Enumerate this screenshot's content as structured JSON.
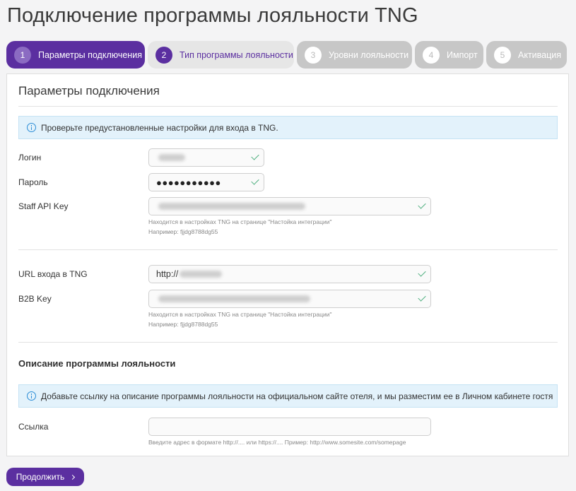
{
  "page": {
    "title": "Подключение программы лояльности TNG"
  },
  "steps": [
    {
      "num": "1",
      "label": "Параметры подключения",
      "state": "active"
    },
    {
      "num": "2",
      "label": "Тип программы лояльности",
      "state": "done"
    },
    {
      "num": "3",
      "label": "Уровни лояльности",
      "state": "inactive"
    },
    {
      "num": "4",
      "label": "Импорт",
      "state": "inactive"
    },
    {
      "num": "5",
      "label": "Активация",
      "state": "inactive"
    }
  ],
  "connection": {
    "title": "Параметры подключения",
    "info": "Проверьте предустановленные настройки для входа в TNG.",
    "login_label": "Логин",
    "password_label": "Пароль",
    "password_value": "●●●●●●●●●●●",
    "staff_key_label": "Staff API Key",
    "staff_hint": "Находится в настройках TNG на странице \"Настойка интеграции\"",
    "staff_example": "Например: fjjdg8788dg55",
    "url_label": "URL входа в TNG",
    "url_prefix": "http://",
    "b2b_label": "B2B Key",
    "b2b_hint": "Находится в настройках TNG на странице \"Настойка интеграции\"",
    "b2b_example": "Например: fjjdg8788dg55"
  },
  "description": {
    "title": "Описание программы лояльности",
    "info": "Добавьте ссылку на описание программы лояльности на официальном сайте отеля, и мы разместим ее в Личном кабинете гостя",
    "link_label": "Ссылка",
    "link_value": "",
    "link_hint": "Введите адрес в формате http://.... или https://.... Пример: http://www.somesite.com/somepage"
  },
  "actions": {
    "continue_label": "Продолжить"
  },
  "colors": {
    "accent": "#5b2fa0",
    "success": "#4cae7d",
    "info_bg": "#e3f2fb"
  }
}
